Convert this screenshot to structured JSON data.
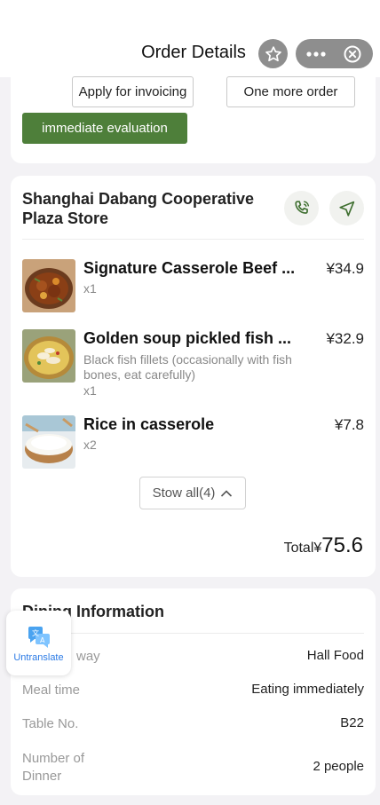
{
  "header": {
    "title": "Order Details",
    "star_icon": "star-icon",
    "more_icon": "more-dots-icon",
    "close_icon": "close-circle-icon"
  },
  "actions": {
    "invoice_label": "Apply for invoicing",
    "more_order_label": "One more order",
    "evaluate_label": "immediate evaluation"
  },
  "store": {
    "name": "Shanghai Dabang Cooperative Plaza Store",
    "phone_icon": "phone-icon",
    "navigate_icon": "navigate-icon"
  },
  "items": [
    {
      "name": "Signature Casserole Beef ...",
      "price": "¥34.9",
      "desc": "",
      "qty": "x1"
    },
    {
      "name": "Golden soup pickled fish ...",
      "price": "¥32.9",
      "desc": "Black fish fillets (occasionally with fish bones, eat carefully)",
      "qty": "x1"
    },
    {
      "name": "Rice in casserole",
      "price": "¥7.8",
      "desc": "",
      "qty": "x2"
    }
  ],
  "show_all_label": "Stow all(4)",
  "total": {
    "label": "Total¥",
    "amount": "75.6"
  },
  "dining": {
    "title": "Dining Information",
    "rows": [
      {
        "label": "way",
        "value": "Hall Food"
      },
      {
        "label": "Meal time",
        "value": "Eating immediately"
      },
      {
        "label": "Table No.",
        "value": "B22"
      },
      {
        "label": "Number of Dinner",
        "value": "2 people"
      }
    ]
  },
  "untranslate_label": "Untranslate",
  "colors": {
    "accent": "#4e7f3a",
    "capsule": "#8e8e8e",
    "link": "#2c7be5"
  }
}
